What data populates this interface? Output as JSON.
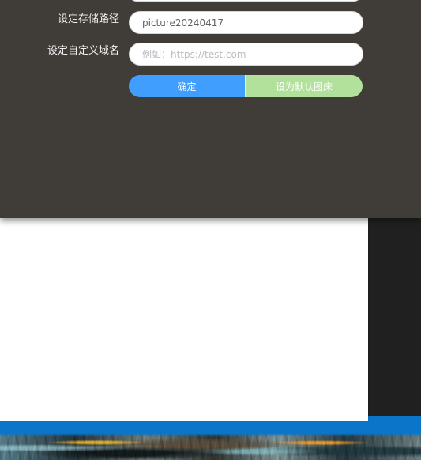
{
  "settings": {
    "storage_path_label": "设定存储路径",
    "storage_path_value": "picture20240417",
    "custom_domain_label": "设定自定义域名",
    "custom_domain_placeholder": "例如：https://test.com",
    "confirm_button": "确定",
    "default_image_host_button": "设为默认图床"
  },
  "colors": {
    "panel_background": "#403c37",
    "confirm_button": "#409eff",
    "default_button": "#b2e19b",
    "accent_strip": "#0a75c9"
  },
  "icons": []
}
